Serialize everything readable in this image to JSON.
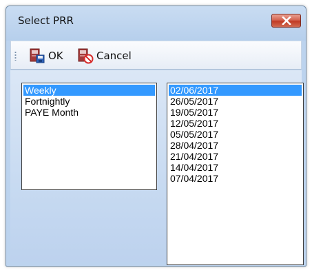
{
  "window": {
    "title": "Select PRR"
  },
  "toolbar": {
    "ok_label": "OK",
    "cancel_label": "Cancel"
  },
  "frequency_list": {
    "items": [
      "Weekly",
      "Fortnightly",
      "PAYE Month"
    ],
    "selected": "Weekly"
  },
  "date_list": {
    "items": [
      "02/06/2017",
      "26/05/2017",
      "19/05/2017",
      "12/05/2017",
      "05/05/2017",
      "28/04/2017",
      "21/04/2017",
      "14/04/2017",
      "07/04/2017"
    ],
    "selected": "02/06/2017"
  },
  "colors": {
    "selection": "#3399ff",
    "window_background": "#bcd3ee",
    "close_button": "#c23b24"
  },
  "icons": {
    "ok": "save-disk-icon",
    "cancel": "cancel-document-icon",
    "close": "close-icon"
  }
}
